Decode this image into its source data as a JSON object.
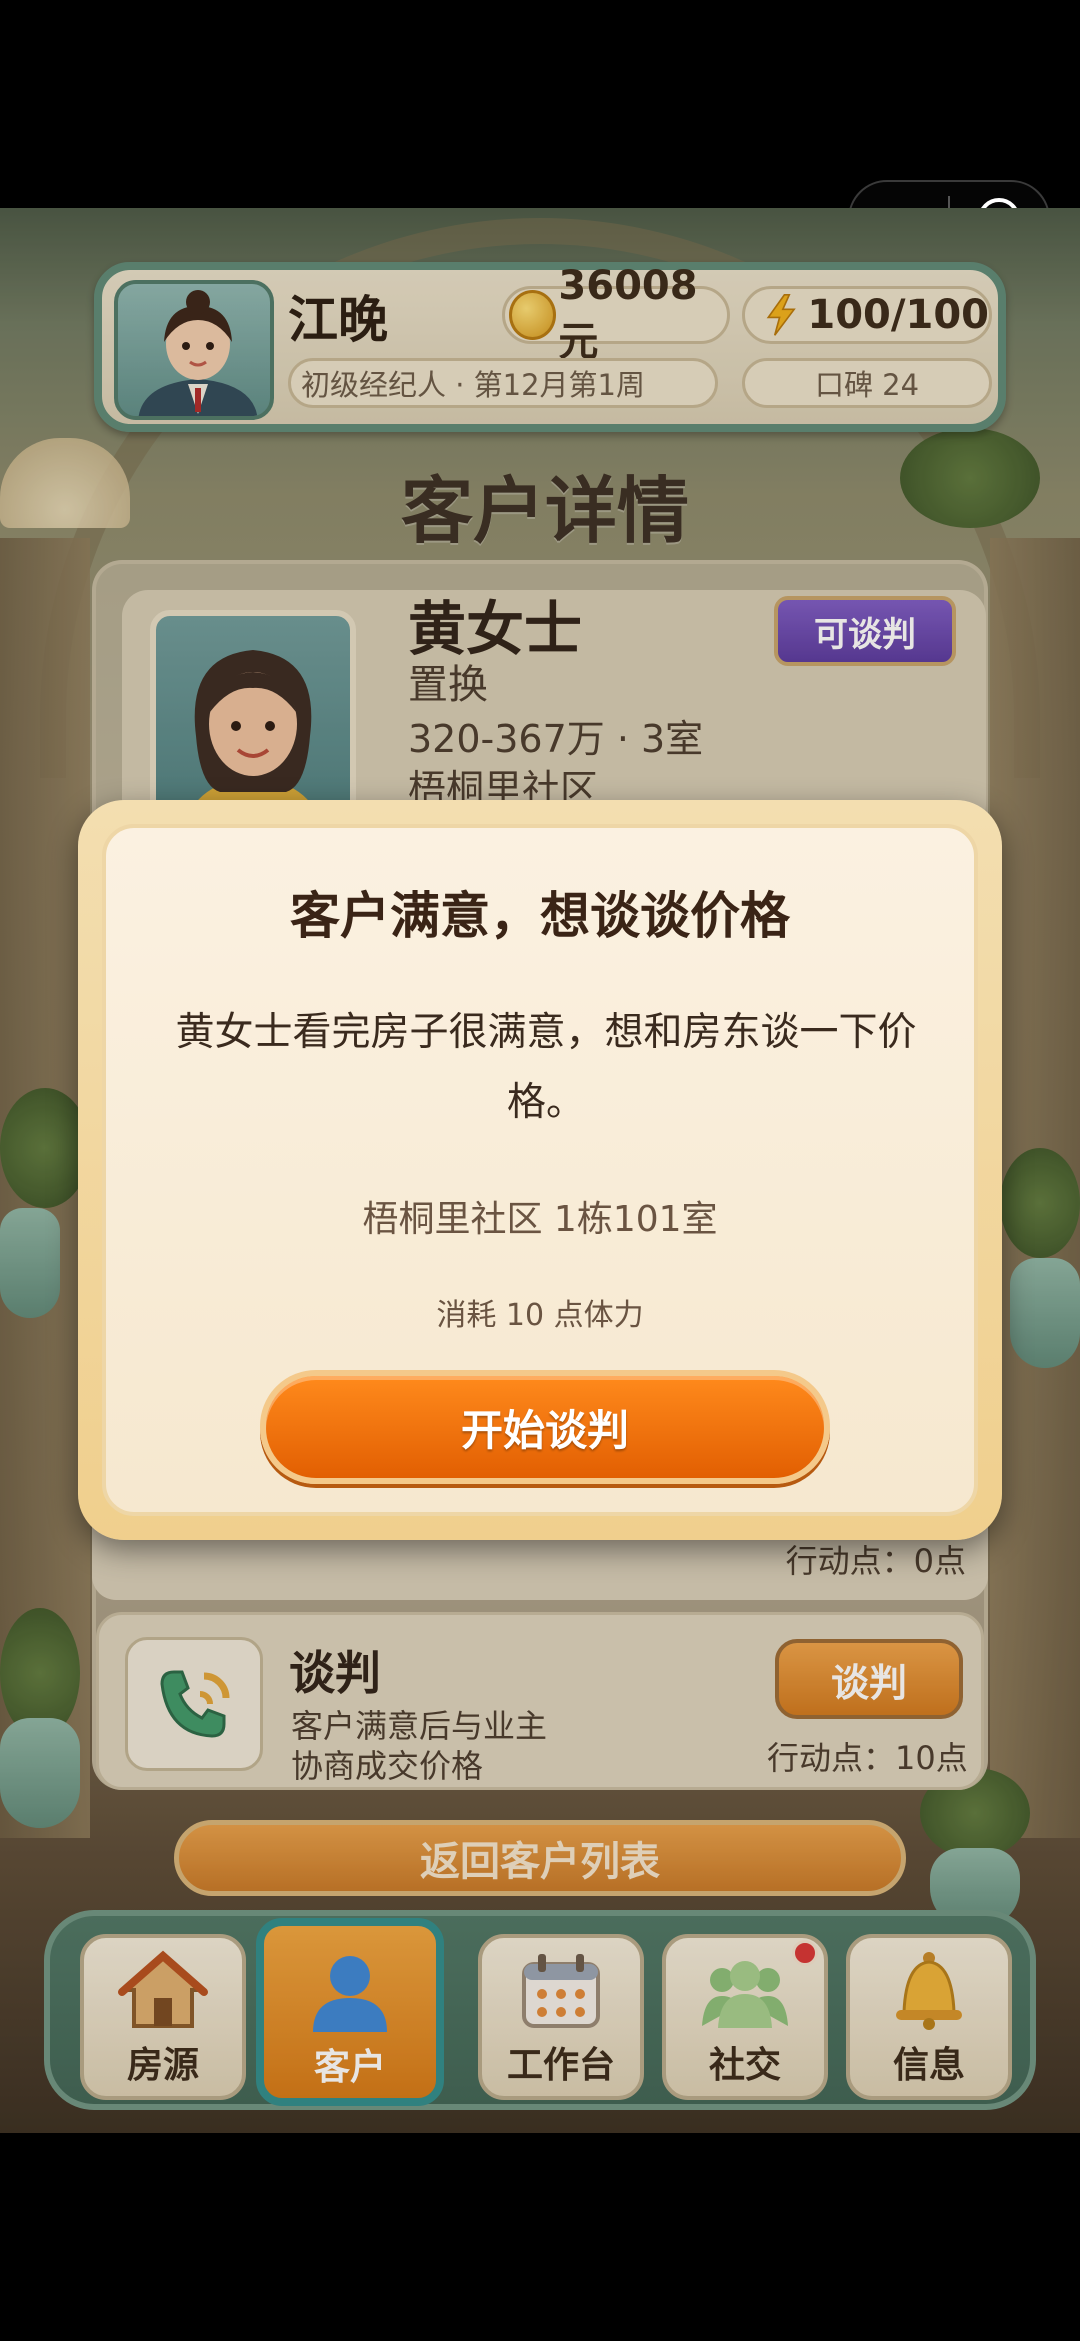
{
  "capsule": {
    "more_glyph": "•●•"
  },
  "player": {
    "name": "江晚",
    "coins": "36008元",
    "energy": "100/100",
    "rank_week": "初级经纪人 · 第12月第1周",
    "reputation": "口碑 24"
  },
  "page": {
    "title": "客户详情"
  },
  "client": {
    "name": "黄女士",
    "type": "置换",
    "budget": "320-367万 · 3室",
    "area": "梧桐里社区",
    "status_badge": "可谈判"
  },
  "actions": {
    "partial_points": "行动点：0点",
    "negotiate": {
      "title": "谈判",
      "desc_line1": "客户满意后与业主",
      "desc_line2": "协商成交价格",
      "button": "谈判",
      "points": "行动点：10点"
    }
  },
  "back_button": "返回客户列表",
  "nav": {
    "items": [
      {
        "label": "房源",
        "icon": "house-icon"
      },
      {
        "label": "客户",
        "icon": "person-icon"
      },
      {
        "label": "工作台",
        "icon": "calendar-icon"
      },
      {
        "label": "社交",
        "icon": "group-icon"
      },
      {
        "label": "信息",
        "icon": "bell-icon"
      }
    ],
    "active_index": 1
  },
  "modal": {
    "title": "客户满意，想谈谈价格",
    "message": "黄女士看完房子很满意，想和房东谈一下价格。",
    "address": "梧桐里社区 1栋101室",
    "cost": "消耗 10 点体力",
    "start_button": "开始谈判"
  },
  "colors": {
    "accent_orange": "#e86f08",
    "badge_purple": "#6a48b4",
    "nav_green": "#4a7263"
  }
}
